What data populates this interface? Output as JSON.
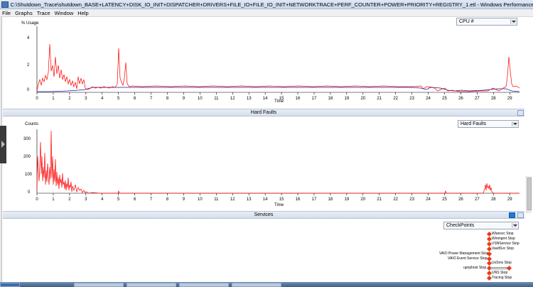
{
  "window": {
    "title": "C:\\Shutdown_Trace\\shutdown_BASE+LATENCY+DISK_IO_INIT+DISPATCHER+DRIVERS+FILE_IO+FILE_IO_INIT+NETWORKTRACE+PERF_COUNTER+POWER+PRIORITY+REGISTRY_1.etl - Windows Performance Analyzer"
  },
  "menu": [
    "File",
    "Graphs",
    "Trace",
    "Window",
    "Help"
  ],
  "cpu_panel": {
    "ylabel": "% Usage",
    "selector": "CPU #",
    "xlabel": "Time",
    "yticks": [
      "4",
      "2",
      "0"
    ],
    "xticks": [
      "0",
      "1",
      "2",
      "3",
      "4",
      "5",
      "6",
      "7",
      "8",
      "9",
      "10",
      "11",
      "12",
      "13",
      "14",
      "15",
      "16",
      "17",
      "18",
      "19",
      "20",
      "21",
      "22",
      "23",
      "24",
      "25",
      "26",
      "27",
      "28",
      "29"
    ]
  },
  "hard_faults_panel": {
    "header": "Hard Faults",
    "ylabel": "Counts",
    "selector": "Hard Faults",
    "xlabel": "Time",
    "yticks": [
      "300",
      "200",
      "100",
      "0"
    ],
    "xticks": [
      "0",
      "1",
      "2",
      "3",
      "4",
      "5",
      "6",
      "7",
      "8",
      "9",
      "10",
      "11",
      "12",
      "13",
      "14",
      "15",
      "16",
      "17",
      "18",
      "19",
      "20",
      "21",
      "22",
      "23",
      "24",
      "25",
      "26",
      "27",
      "28",
      "29"
    ]
  },
  "services_panel": {
    "header": "Services",
    "selector": "CheckPoints",
    "checkpoints": [
      "Wlansvc Stop",
      "Winmgmt Stop",
      "VSNService Stop",
      "VaultSvc Stop",
      "VAIO Power Management Stop",
      "VAIO Event Service Stop",
      "UxSms Stop",
      "upnphost Stop",
      "UNS Stop",
      "Tracing Stop"
    ]
  },
  "colors": {
    "series_red": "#ff0000",
    "series_blue": "#1a1aa8",
    "header_bg": "#dde6f1",
    "accent_blue": "#1b7bd6"
  }
}
